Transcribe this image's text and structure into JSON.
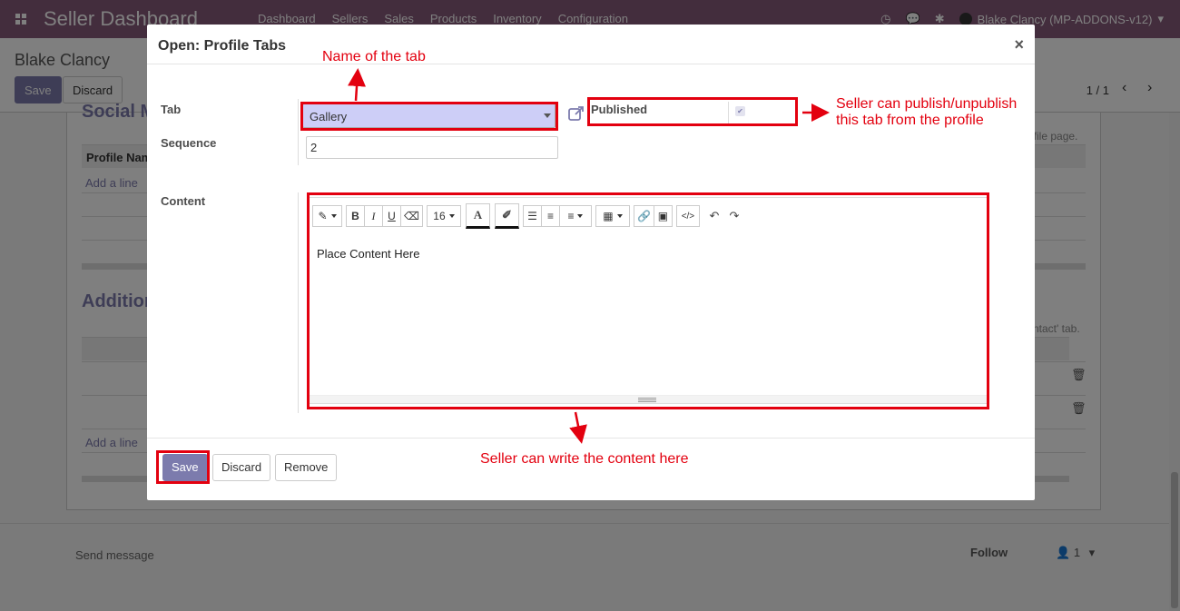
{
  "app": {
    "brand": "Seller Dashboard",
    "menu": [
      "Dashboard",
      "Sellers",
      "Sales",
      "Products",
      "Inventory",
      "Configuration"
    ],
    "user": "Blake Clancy (MP-ADDONS-v12)"
  },
  "control_panel": {
    "breadcrumb": "Blake Clancy",
    "save_label": "Save",
    "discard_label": "Discard",
    "pager": "1 / 1"
  },
  "sheet": {
    "section1_heading": "Social M",
    "section2_heading": "Addition",
    "col_profile_name": "Profile Nam",
    "add_line": "Add a line",
    "note1": "ofile page.",
    "note2": "ntact' tab."
  },
  "chatter": {
    "send_message": "Send message",
    "follow": "Follow",
    "followers": "1"
  },
  "modal": {
    "title": "Open: Profile Tabs",
    "close": "×",
    "tab_label": "Tab",
    "tab_value": "Gallery",
    "published_label": "Published",
    "published": true,
    "sequence_label": "Sequence",
    "sequence_value": "2",
    "content_label": "Content",
    "editor_font_size": "16",
    "editor_content": "Place Content Here",
    "save": "Save",
    "discard": "Discard",
    "remove": "Remove"
  },
  "annotations": {
    "tab_name": "Name of the tab",
    "publish_line1": "Seller can publish/unpublish",
    "publish_line2": "this tab from the profile",
    "content": "Seller can write the content here"
  },
  "colors": {
    "brand": "#875a7b",
    "primary": "#7c7bad",
    "annotation": "#e3000f"
  }
}
